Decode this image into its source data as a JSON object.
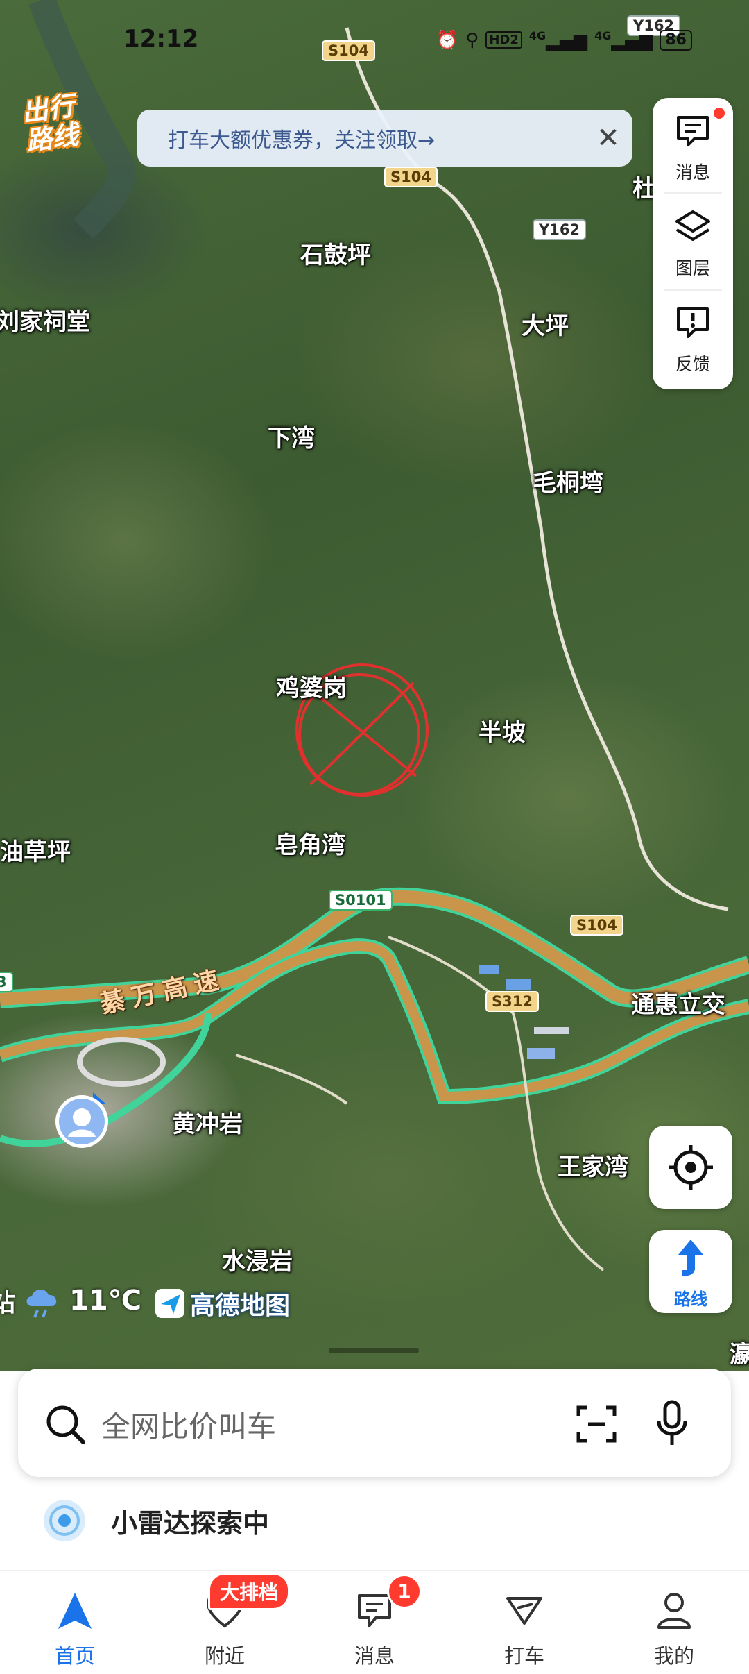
{
  "status_bar": {
    "time": "12:12",
    "network1": "4G",
    "network2": "4G",
    "hd": "HD2",
    "battery": "86"
  },
  "logo_text": "出行路线",
  "banner": {
    "text": "打车大额优惠券，关注领取→",
    "close": "✕"
  },
  "tools": {
    "message_label": "消息",
    "layers_label": "图层",
    "feedback_label": "反馈"
  },
  "locate_button": "locate",
  "route_button_label": "路线",
  "map": {
    "places": [
      "石鼓坪",
      "刘家祠堂",
      "大坪",
      "下湾",
      "毛桐塆",
      "鸡婆岗",
      "半坡",
      "油草坪",
      "皂角湾",
      "通惠立交",
      "黄冲岩",
      "王家湾",
      "水浸岩",
      "杜",
      "瀛"
    ],
    "roads": [
      "S104",
      "Y162",
      "S104",
      "Y162",
      "S0101",
      "S104",
      "S312",
      "3"
    ],
    "highway_name": "綦万高速"
  },
  "weather": {
    "icon": "cloud-rain-icon",
    "temperature": "11℃",
    "edge_text": "站"
  },
  "amap_logo": "高德地图",
  "search": {
    "placeholder": "全网比价叫车"
  },
  "radar": {
    "text": "小雷达探索中"
  },
  "tabs": [
    {
      "label": "首页",
      "active": true
    },
    {
      "label": "附近",
      "badge": "大排档"
    },
    {
      "label": "消息",
      "badge": "1"
    },
    {
      "label": "打车"
    },
    {
      "label": "我的"
    }
  ],
  "colors": {
    "accent": "#1a73e8",
    "badge": "#ff3b30",
    "highway": "#c9954b",
    "highway_edge": "#40d39a"
  }
}
